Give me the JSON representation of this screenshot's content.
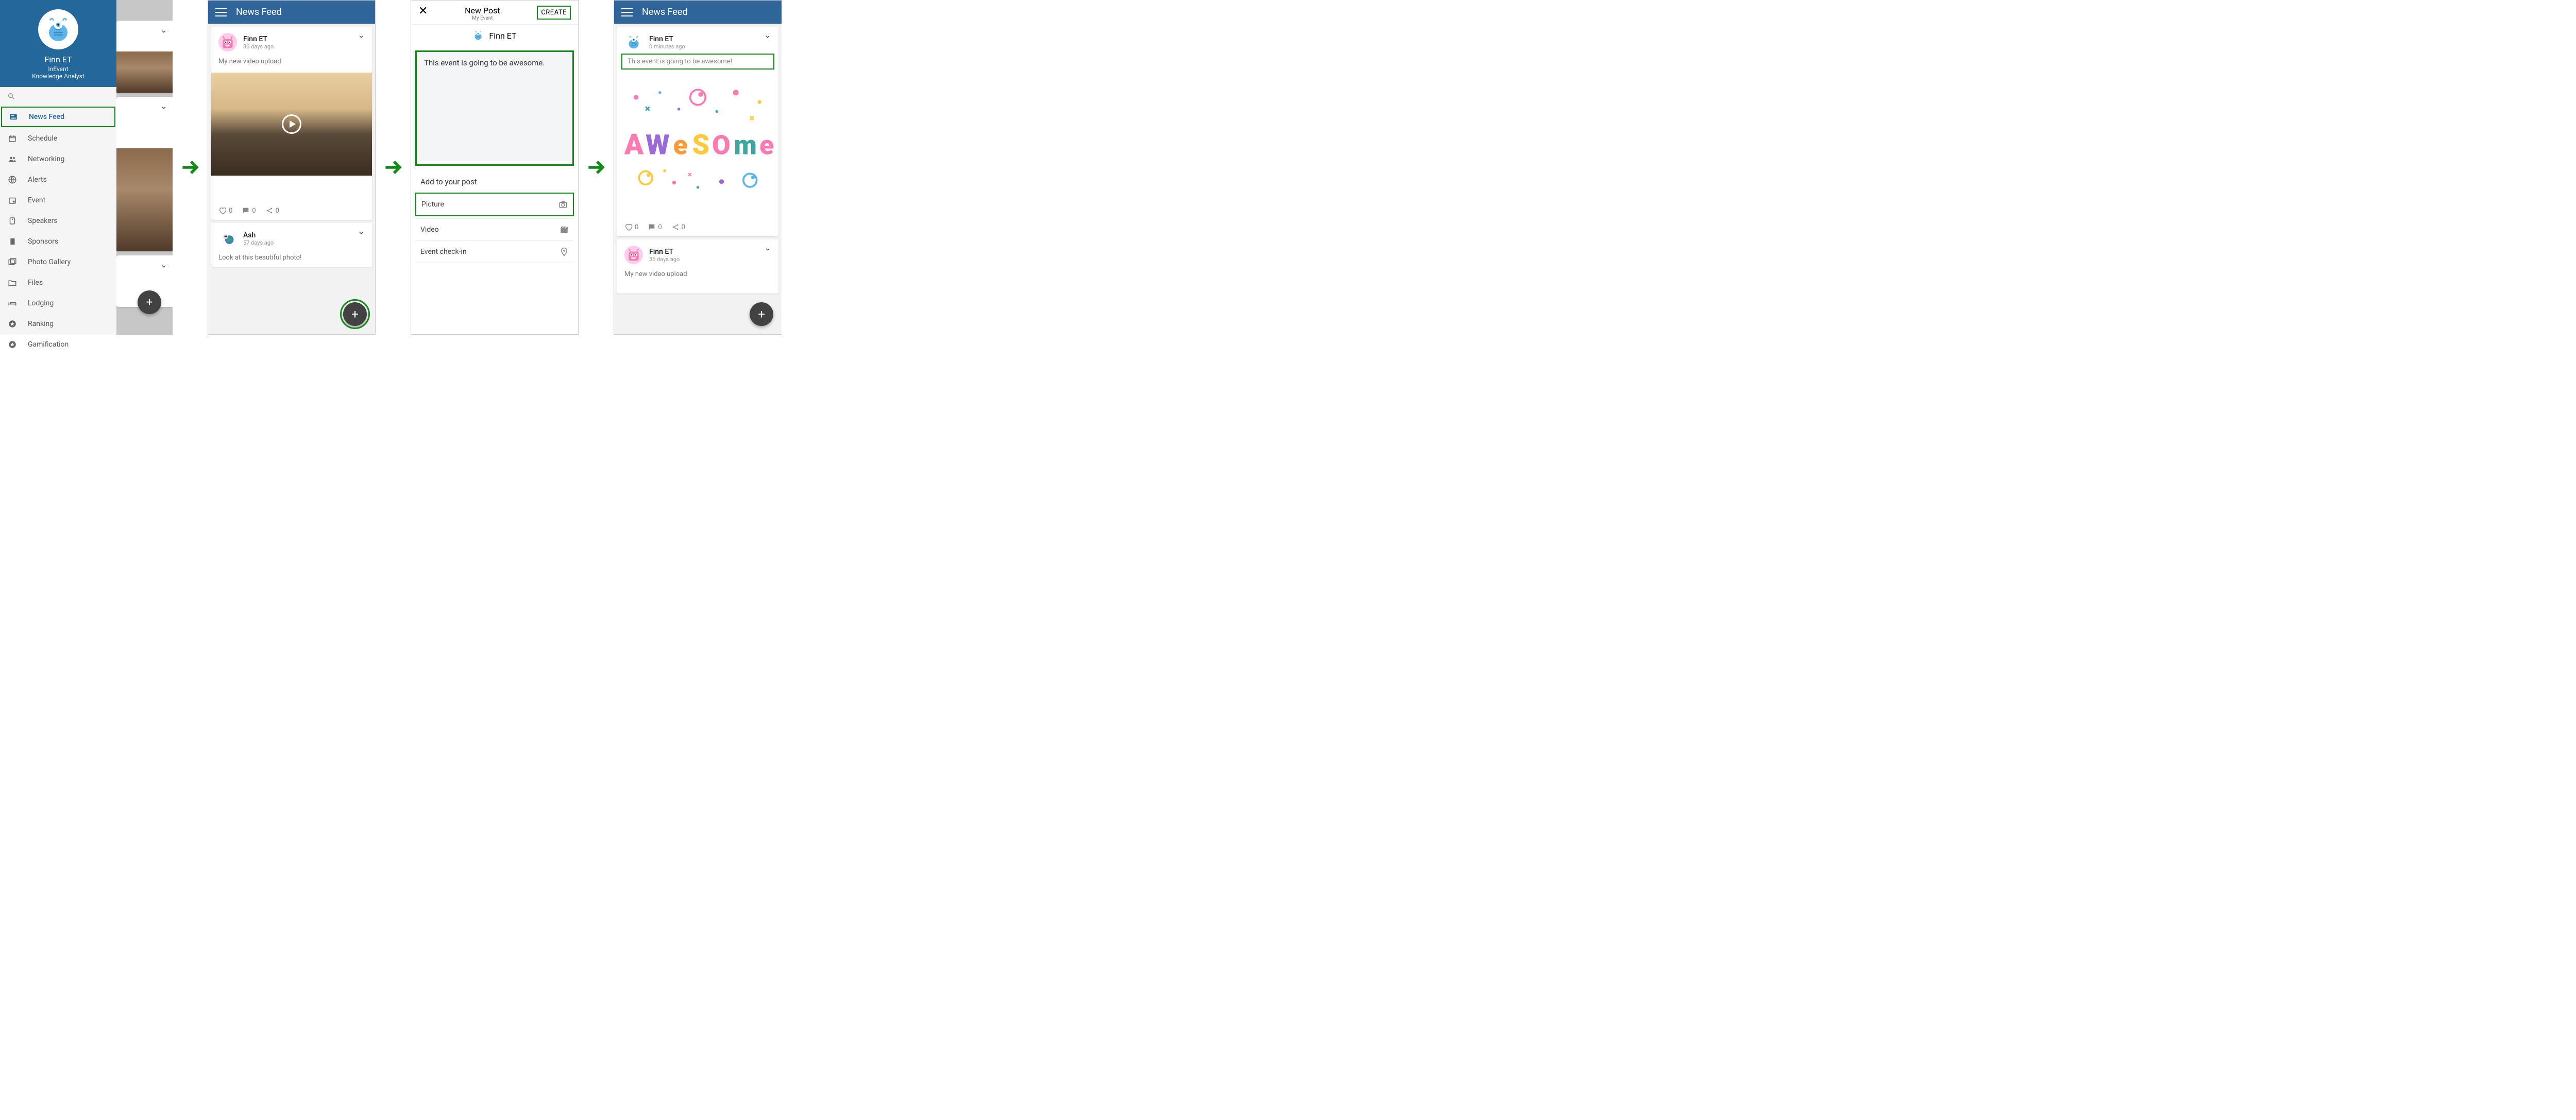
{
  "sidebar": {
    "profile": {
      "name": "Finn ET",
      "org": "InEvent",
      "role": "Knowledge Analyst"
    },
    "items": [
      {
        "label": "News Feed",
        "icon": "feed",
        "active": true
      },
      {
        "label": "Schedule",
        "icon": "calendar"
      },
      {
        "label": "Networking",
        "icon": "people"
      },
      {
        "label": "Alerts",
        "icon": "globe"
      },
      {
        "label": "Event",
        "icon": "event"
      },
      {
        "label": "Speakers",
        "icon": "speaker"
      },
      {
        "label": "Sponsors",
        "icon": "bookmark"
      },
      {
        "label": "Photo Gallery",
        "icon": "gallery"
      },
      {
        "label": "Files",
        "icon": "folder"
      },
      {
        "label": "Lodging",
        "icon": "bed"
      },
      {
        "label": "Ranking",
        "icon": "star"
      },
      {
        "label": "Gamification",
        "icon": "star"
      }
    ]
  },
  "feed_title": "News Feed",
  "panel2": {
    "post1": {
      "user": "Finn ET",
      "time": "36 days ago",
      "body": "My new video upload",
      "like": "0",
      "comment": "0",
      "share": "0"
    },
    "post2": {
      "user": "Ash",
      "time": "57 days ago",
      "body": "Look at this beautiful photo!"
    }
  },
  "panel3": {
    "title": "New Post",
    "subtitle": "My Event",
    "create": "CREATE",
    "author": "Finn ET",
    "textarea": "This event is going to be awesome.",
    "add_label": "Add to your post",
    "opts": [
      {
        "label": "Picture",
        "icon": "camera",
        "hl": true
      },
      {
        "label": "Video",
        "icon": "clapper"
      },
      {
        "label": "Event check-in",
        "icon": "pin"
      }
    ]
  },
  "panel4": {
    "post1": {
      "user": "Finn ET",
      "time": "0 minutes ago",
      "body": "This event is going to be awesome!",
      "like": "0",
      "comment": "0",
      "share": "0"
    },
    "post2": {
      "user": "Finn ET",
      "time": "36 days ago",
      "body": "My new video upload"
    }
  }
}
